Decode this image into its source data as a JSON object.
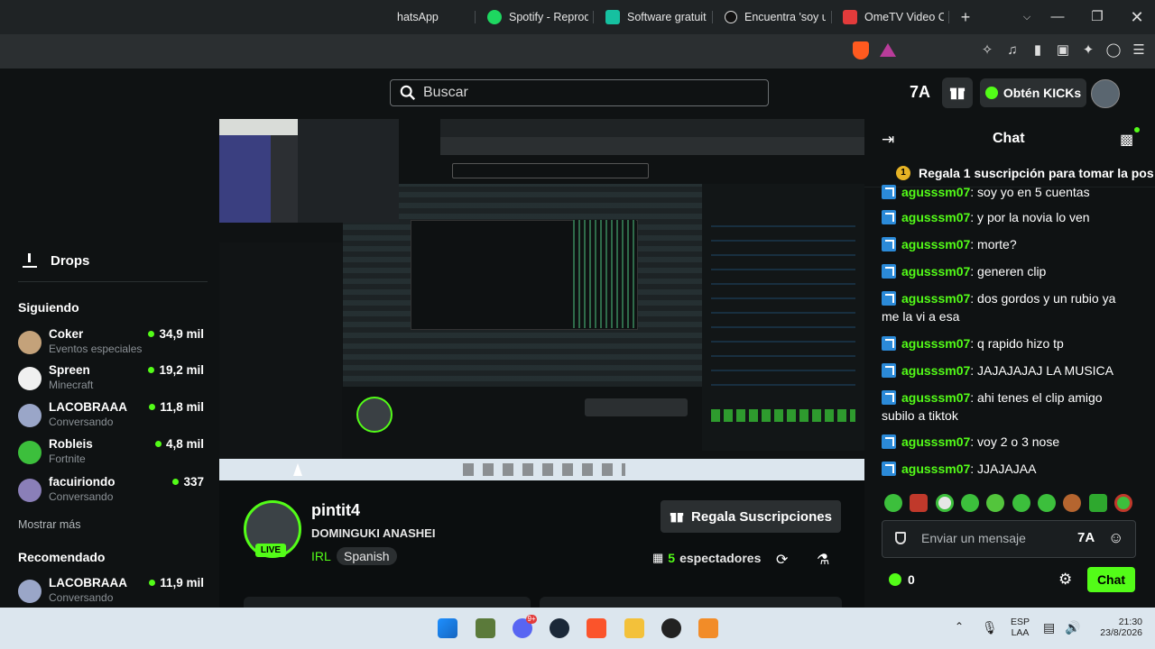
{
  "tabs": [
    {
      "label": "hatsApp",
      "color": "#25d366"
    },
    {
      "label": "Spotify - Reprodu",
      "color": "#1ed760"
    },
    {
      "label": "Software gratuito",
      "color": "#16c0a0"
    },
    {
      "label": "Encuentra 'soy u",
      "color": "#111111"
    },
    {
      "label": "OmeTV Video Ch",
      "color": "#e23b3b"
    }
  ],
  "header": {
    "search_placeholder": "Buscar",
    "obtain_kicks": "Obtén KICKs"
  },
  "sidebar": {
    "drops_label": "Drops",
    "following_label": "Siguiendo",
    "following": [
      {
        "name": "Coker",
        "sub": "Eventos especiales",
        "viewers": "34,9 mil",
        "color": "#c4a27a"
      },
      {
        "name": "Spreen",
        "sub": "Minecraft",
        "viewers": "19,2 mil",
        "color": "#f0f0f0"
      },
      {
        "name": "LACOBRAAA",
        "sub": "Conversando",
        "viewers": "11,8 mil",
        "color": "#9aa6c8"
      },
      {
        "name": "Robleis",
        "sub": "Fortnite",
        "viewers": "4,8 mil",
        "color": "#3cbf3c"
      },
      {
        "name": "facuiriondo",
        "sub": "Conversando",
        "viewers": "337",
        "color": "#8a7fb8"
      }
    ],
    "show_more": "Mostrar más",
    "recommended_label": "Recomendado",
    "recommended": [
      {
        "name": "LACOBRAAA",
        "sub": "Conversando",
        "viewers": "11,9 mil",
        "color": "#9aa6c8"
      }
    ]
  },
  "stream": {
    "channel": "pintit4",
    "title": "DOMINGUKI ANASHEI",
    "category": "IRL",
    "language": "Spanish",
    "live_badge": "LIVE",
    "gift_button": "Regala Suscripciones",
    "viewers_count": "5",
    "viewers_label": "espectadores"
  },
  "chat": {
    "title": "Chat",
    "pinned": "Regala 1 suscripción para tomar la pos",
    "messages": [
      {
        "user": "agusssm07",
        "text": ": soy yo en 5 cuentas"
      },
      {
        "user": "agusssm07",
        "text": ": y por la novia lo ven"
      },
      {
        "user": "agusssm07",
        "text": ": morte?"
      },
      {
        "user": "agusssm07",
        "text": ": generen clip"
      },
      {
        "user": "agusssm07",
        "text": ": dos gordos y un rubio ya me la vi a esa"
      },
      {
        "user": "agusssm07",
        "text": ": q rapido hizo tp"
      },
      {
        "user": "agusssm07",
        "text": ": JAJAJAJAJ LA MUSICA"
      },
      {
        "user": "agusssm07",
        "text": ": ahi tenes el clip amigo subilo a tiktok"
      },
      {
        "user": "agusssm07",
        "text": ": voy 2 o 3 nose"
      },
      {
        "user": "agusssm07",
        "text": ": JJAJAJAA"
      }
    ],
    "input_placeholder": "Enviar un mensaje",
    "kicks_count": "0",
    "send_button": "Chat"
  },
  "taskbar": {
    "lang": "ESP",
    "lang_sub": "LAA",
    "time": "21:30",
    "date": "23/8/2026"
  }
}
